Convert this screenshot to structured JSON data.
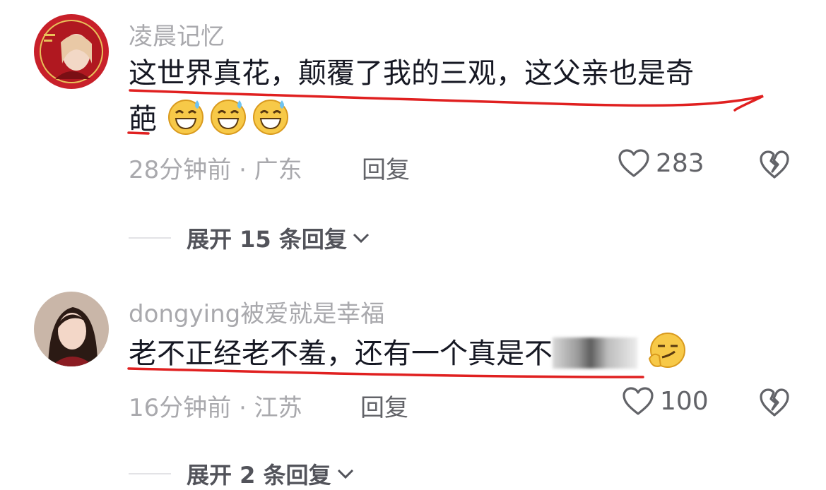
{
  "comments": [
    {
      "username": "凌晨记忆",
      "text_line1": "这世界真花，颠覆了我的三观，这父亲也是奇",
      "text_line2": "葩",
      "time_location": "28分钟前 · 广东",
      "reply_label": "回复",
      "likes": "283",
      "expand_label": "展开 15 条回复",
      "emoji": "sweat-grin-emoji"
    },
    {
      "username": "dongying被爱就是幸福",
      "text": "老不正经老不羞，还有一个真是不",
      "time_location": "16分钟前 · 江苏",
      "reply_label": "回复",
      "likes": "100",
      "expand_label": "展开 2 条回复",
      "emoji": "smirk-emoji"
    }
  ],
  "colors": {
    "text": "#161823",
    "secondary": "#a9a9ad",
    "underline": "#e02020",
    "avatar1_bg": "#c8202a"
  }
}
